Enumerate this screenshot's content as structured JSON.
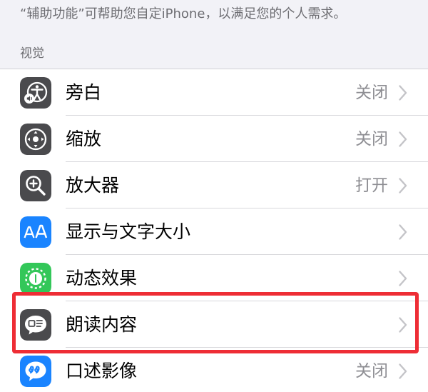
{
  "intro_text": "“辅助功能”可帮助您自定iPhone，以满足您的个人需求。",
  "section": {
    "title": "视觉"
  },
  "colors": {
    "dark_icon_bg": "#4a4a4d",
    "blue_icon_bg": "#1a84ff",
    "green_icon_bg": "#33c759",
    "highlight": "#ee2d35"
  },
  "items": [
    {
      "label": "旁白",
      "value": "关闭",
      "icon": "voiceover-icon"
    },
    {
      "label": "缩放",
      "value": "关闭",
      "icon": "zoom-icon"
    },
    {
      "label": "放大器",
      "value": "打开",
      "icon": "magnifier-icon"
    },
    {
      "label": "显示与文字大小",
      "value": "",
      "icon": "text-size-icon"
    },
    {
      "label": "动态效果",
      "value": "",
      "icon": "motion-icon"
    },
    {
      "label": "朗读内容",
      "value": "",
      "icon": "spoken-content-icon"
    },
    {
      "label": "口述影像",
      "value": "关闭",
      "icon": "audio-description-icon"
    }
  ]
}
